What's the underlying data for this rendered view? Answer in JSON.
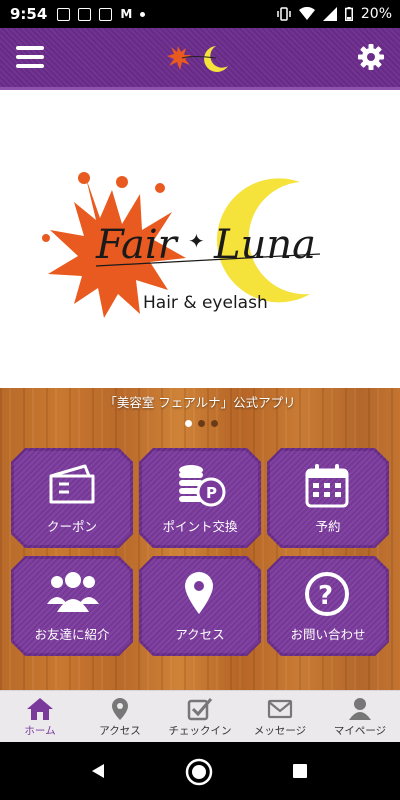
{
  "status": {
    "time": "9:54",
    "battery": "20%"
  },
  "tagline": "「美容室 フェアルナ」公式アプリ",
  "logo": {
    "main_left": "Fair",
    "main_right": "Luna",
    "sub": "Hair & eyelash"
  },
  "tiles": [
    {
      "label": "クーポン",
      "icon": "ticket-icon"
    },
    {
      "label": "ポイント交換",
      "icon": "coins-point-icon"
    },
    {
      "label": "予約",
      "icon": "calendar-icon"
    },
    {
      "label": "お友達に紹介",
      "icon": "group-icon"
    },
    {
      "label": "アクセス",
      "icon": "map-pin-icon"
    },
    {
      "label": "お問い合わせ",
      "icon": "question-icon"
    }
  ],
  "tabs": [
    {
      "label": "ホーム",
      "icon": "home-icon"
    },
    {
      "label": "アクセス",
      "icon": "map-pin-icon"
    },
    {
      "label": "チェックイン",
      "icon": "checkbox-icon"
    },
    {
      "label": "メッセージ",
      "icon": "envelope-icon"
    },
    {
      "label": "マイページ",
      "icon": "person-icon"
    }
  ],
  "colors": {
    "brand": "#6b2d8c",
    "active_tab": "#7a3a9c",
    "logo_orange": "#e85a1f",
    "logo_yellow": "#f5e23a"
  }
}
